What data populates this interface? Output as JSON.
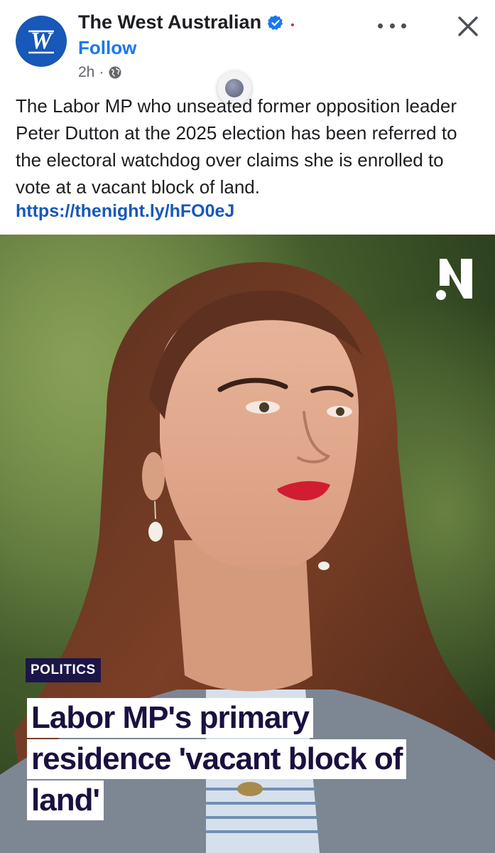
{
  "post": {
    "page_name": "The West Australian",
    "follow_label": "Follow",
    "time": "2h",
    "separator": "·",
    "avatar_letters": "W",
    "caption": "The Labor MP who unseated former opposition leader Peter Dutton at the 2025 election has been referred to the electoral watchdog over claims she is enrolled to vote at a vacant block of land.",
    "link": "https://thenight.ly/hFO0eJ"
  },
  "article": {
    "tag": "POLITICS",
    "headline_lines": [
      "Labor MP's primary",
      "residence 'vacant block of",
      "land'"
    ]
  },
  "icons": {
    "verified": "verified-badge-icon",
    "globe": "globe-icon",
    "more": "more-options-icon",
    "close": "close-icon",
    "brand": "brand-n-logo"
  },
  "colors": {
    "facebook_blue": "#1877f2",
    "link_blue": "#1758b8",
    "avatar_blue": "#1758b8",
    "tag_bg": "#1b1647",
    "headline_text": "#1b1040"
  }
}
